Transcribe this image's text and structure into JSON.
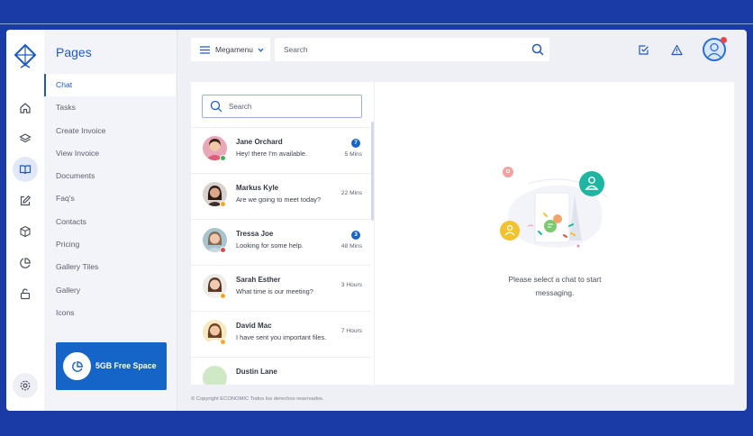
{
  "sidebar": {
    "title": "Pages",
    "items": [
      {
        "label": "Chat",
        "active": true
      },
      {
        "label": "Tasks"
      },
      {
        "label": "Create Invoice"
      },
      {
        "label": "View Invoice"
      },
      {
        "label": "Documents"
      },
      {
        "label": "Faq's"
      },
      {
        "label": "Contacts"
      },
      {
        "label": "Pricing"
      },
      {
        "label": "Gallery Tiles"
      },
      {
        "label": "Gallery"
      },
      {
        "label": "Icons"
      }
    ],
    "space_card": {
      "label": "5GB Free Space",
      "icon": "pie-chart-icon"
    }
  },
  "rail": {
    "icons": [
      "home-icon",
      "layers-icon",
      "book-icon",
      "edit-icon",
      "box-icon",
      "pie-chart-icon",
      "unlock-icon",
      "settings-icon"
    ],
    "active": "book-icon"
  },
  "header": {
    "megamenu_label": "Megamenu",
    "search_placeholder": "Search",
    "icons": [
      "check-square-icon",
      "alert-triangle-icon",
      "user-avatar"
    ]
  },
  "chat": {
    "search_placeholder": "Search",
    "items": [
      {
        "name": "Jane Orchard",
        "message": "Hey! there I'm available.",
        "time": "5 Mins",
        "badge": "7",
        "status": "online"
      },
      {
        "name": "Markus Kyle",
        "message": "Are we going to meet today?",
        "time": "22 Mins",
        "status": "away"
      },
      {
        "name": "Tressa Joe",
        "message": "Looking for some help.",
        "time": "48 Mins",
        "badge": "3",
        "status": "busy"
      },
      {
        "name": "Sarah Esther",
        "message": "What time is our meeting?",
        "time": "3 Hours",
        "status": "away"
      },
      {
        "name": "David Mac",
        "message": "I have sent you important files.",
        "time": "7 Hours",
        "status": "away"
      },
      {
        "name": "Dustin Lane",
        "message": "",
        "time": ""
      }
    ],
    "empty_message": "Please select a chat to start messaging."
  },
  "footer": {
    "text": "© Copyright ECONOMIC Todos los derechos reservados."
  },
  "colors": {
    "brand": "#1565c8",
    "background": "#1a3aa6",
    "online": "#3cb44b",
    "away": "#f5a623",
    "busy": "#e64545"
  }
}
